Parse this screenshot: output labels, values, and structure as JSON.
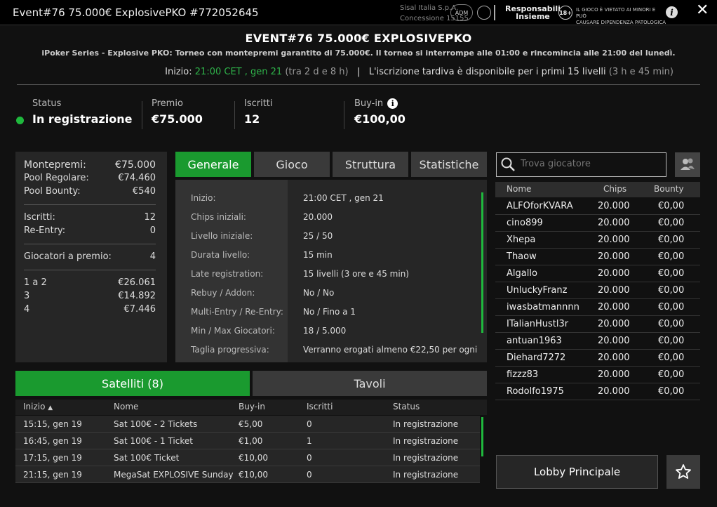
{
  "window": {
    "title": "Event#76 75.000€ ExplosivePKO #772052645",
    "company_line1": "Sisal Italia S.p.A.",
    "company_line2": "Concessione 15155",
    "badge_adm": "ADM",
    "responsible_line1": "Responsabili",
    "responsible_line2": "Insieme",
    "age_badge": "18+",
    "warning_line1": "IL GIOCO È VIETATO AI MINORI E PUÒ",
    "warning_line2": "CAUSARE DIPENDENZA PATOLOGICA"
  },
  "header": {
    "title": "EVENT#76 75.000€ EXPLOSIVEPKO",
    "subtitle": "iPoker Series - Explosive PKO: Torneo con montepremi garantito di 75.000€. Il torneo si interrompe alle 01:00 e rincomincia alle 21:00 del lunedì.",
    "start_label": "Inizio:",
    "start_value": "21:00 CET , gen 21",
    "start_relative": "(tra 2 d e 8 h)",
    "separator": "|",
    "late_text": "L'iscrizione tardiva è disponibile per i primi 15 livelli",
    "late_relative": "(3 h e 45 min)"
  },
  "status_row": {
    "status_label": "Status",
    "status_value": "In registrazione",
    "prize_label": "Premio",
    "prize_value": "€75.000",
    "entrants_label": "Iscritti",
    "entrants_value": "12",
    "buyin_label": "Buy-in",
    "buyin_value": "€100,00"
  },
  "prize_panel": {
    "montepremi_label": "Montepremi:",
    "montepremi_value": "€75.000",
    "pool_regular_label": "Pool Regolare:",
    "pool_regular_value": "€74.460",
    "pool_bounty_label": "Pool Bounty:",
    "pool_bounty_value": "€540",
    "iscritti_label": "Iscritti:",
    "iscritti_value": "12",
    "reentry_label": "Re-Entry:",
    "reentry_value": "0",
    "paid_label": "Giocatori a premio:",
    "paid_value": "4",
    "payouts": [
      {
        "place": "1  a  2",
        "amount": "€26.061"
      },
      {
        "place": "3",
        "amount": "€14.892"
      },
      {
        "place": "4",
        "amount": "€7.446"
      }
    ]
  },
  "tabs": [
    "Generale",
    "Gioco",
    "Struttura",
    "Statistiche"
  ],
  "general": [
    {
      "label": "Inizio:",
      "value": "21:00 CET , gen 21"
    },
    {
      "label": "Chips iniziali:",
      "value": "20.000"
    },
    {
      "label": "Livello iniziale:",
      "value": "25 / 50"
    },
    {
      "label": "Durata livello:",
      "value": "15 min"
    },
    {
      "label": "Late registration:",
      "value": "15 livelli (3 ore e 45 min)"
    },
    {
      "label": "Rebuy / Addon:",
      "value": "No / No"
    },
    {
      "label": "Multi-Entry / Re-Entry:",
      "value": "No / Fino a 1"
    },
    {
      "label": "Min / Max Giocatori:",
      "value": "18 / 5.000"
    },
    {
      "label": "Taglia progressiva:",
      "value": "Verranno erogati almeno €22,50 per ogni"
    }
  ],
  "search": {
    "placeholder": "Trova giocatore"
  },
  "players": {
    "headers": {
      "name": "Nome",
      "chips": "Chips",
      "bounty": "Bounty"
    },
    "rows": [
      {
        "name": "ALFOforKVARA",
        "chips": "20.000",
        "bounty": "€0,00"
      },
      {
        "name": "cino899",
        "chips": "20.000",
        "bounty": "€0,00"
      },
      {
        "name": "Xhepa",
        "chips": "20.000",
        "bounty": "€0,00"
      },
      {
        "name": "Thaow",
        "chips": "20.000",
        "bounty": "€0,00"
      },
      {
        "name": "Algallo",
        "chips": "20.000",
        "bounty": "€0,00"
      },
      {
        "name": "UnluckyFranz",
        "chips": "20.000",
        "bounty": "€0,00"
      },
      {
        "name": "iwasbatmannnn",
        "chips": "20.000",
        "bounty": "€0,00"
      },
      {
        "name": "ITalianHustl3r",
        "chips": "20.000",
        "bounty": "€0,00"
      },
      {
        "name": "antuan1963",
        "chips": "20.000",
        "bounty": "€0,00"
      },
      {
        "name": "Diehard7272",
        "chips": "20.000",
        "bounty": "€0,00"
      },
      {
        "name": "fizzz83",
        "chips": "20.000",
        "bounty": "€0,00"
      },
      {
        "name": "Rodolfo1975",
        "chips": "20.000",
        "bounty": "€0,00"
      }
    ]
  },
  "bottom_tabs": {
    "satellites": "Satelliti (8)",
    "tables": "Tavoli"
  },
  "satellites": {
    "headers": {
      "start": "Inizio",
      "sort_arrow": "▲",
      "name": "Nome",
      "buyin": "Buy-in",
      "entrants": "Iscritti",
      "status": "Status"
    },
    "rows": [
      {
        "start": "15:15, gen 19",
        "name": "Sat 100€ - 2 Tickets",
        "buyin": "€5,00",
        "entrants": "0",
        "status": "In registrazione"
      },
      {
        "start": "16:45, gen 19",
        "name": "Sat 100€ - 1 Ticket",
        "buyin": "€1,00",
        "entrants": "1",
        "status": "In registrazione"
      },
      {
        "start": "17:15, gen 19",
        "name": "Sat 100€ Ticket",
        "buyin": "€10,00",
        "entrants": "0",
        "status": "In registrazione"
      },
      {
        "start": "21:15, gen 19",
        "name": "MegaSat EXPLOSIVE Sunday ...",
        "buyin": "€10,00",
        "entrants": "0",
        "status": "In registrazione"
      }
    ]
  },
  "lobby_button": "Lobby Principale",
  "colors": {
    "accent": "#1a9a2f",
    "status_dot": "#1fb83d",
    "start_time": "#2fb34a"
  }
}
